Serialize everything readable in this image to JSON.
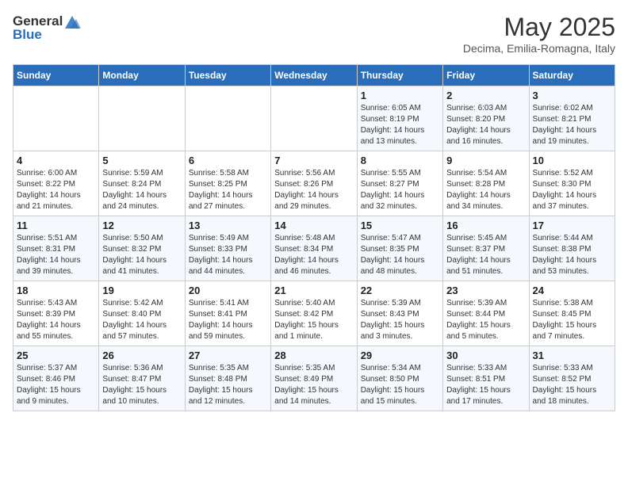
{
  "header": {
    "logo_general": "General",
    "logo_blue": "Blue",
    "month_year": "May 2025",
    "location": "Decima, Emilia-Romagna, Italy"
  },
  "days_of_week": [
    "Sunday",
    "Monday",
    "Tuesday",
    "Wednesday",
    "Thursday",
    "Friday",
    "Saturday"
  ],
  "weeks": [
    [
      {
        "day": "",
        "info": ""
      },
      {
        "day": "",
        "info": ""
      },
      {
        "day": "",
        "info": ""
      },
      {
        "day": "",
        "info": ""
      },
      {
        "day": "1",
        "info": "Sunrise: 6:05 AM\nSunset: 8:19 PM\nDaylight: 14 hours\nand 13 minutes."
      },
      {
        "day": "2",
        "info": "Sunrise: 6:03 AM\nSunset: 8:20 PM\nDaylight: 14 hours\nand 16 minutes."
      },
      {
        "day": "3",
        "info": "Sunrise: 6:02 AM\nSunset: 8:21 PM\nDaylight: 14 hours\nand 19 minutes."
      }
    ],
    [
      {
        "day": "4",
        "info": "Sunrise: 6:00 AM\nSunset: 8:22 PM\nDaylight: 14 hours\nand 21 minutes."
      },
      {
        "day": "5",
        "info": "Sunrise: 5:59 AM\nSunset: 8:24 PM\nDaylight: 14 hours\nand 24 minutes."
      },
      {
        "day": "6",
        "info": "Sunrise: 5:58 AM\nSunset: 8:25 PM\nDaylight: 14 hours\nand 27 minutes."
      },
      {
        "day": "7",
        "info": "Sunrise: 5:56 AM\nSunset: 8:26 PM\nDaylight: 14 hours\nand 29 minutes."
      },
      {
        "day": "8",
        "info": "Sunrise: 5:55 AM\nSunset: 8:27 PM\nDaylight: 14 hours\nand 32 minutes."
      },
      {
        "day": "9",
        "info": "Sunrise: 5:54 AM\nSunset: 8:28 PM\nDaylight: 14 hours\nand 34 minutes."
      },
      {
        "day": "10",
        "info": "Sunrise: 5:52 AM\nSunset: 8:30 PM\nDaylight: 14 hours\nand 37 minutes."
      }
    ],
    [
      {
        "day": "11",
        "info": "Sunrise: 5:51 AM\nSunset: 8:31 PM\nDaylight: 14 hours\nand 39 minutes."
      },
      {
        "day": "12",
        "info": "Sunrise: 5:50 AM\nSunset: 8:32 PM\nDaylight: 14 hours\nand 41 minutes."
      },
      {
        "day": "13",
        "info": "Sunrise: 5:49 AM\nSunset: 8:33 PM\nDaylight: 14 hours\nand 44 minutes."
      },
      {
        "day": "14",
        "info": "Sunrise: 5:48 AM\nSunset: 8:34 PM\nDaylight: 14 hours\nand 46 minutes."
      },
      {
        "day": "15",
        "info": "Sunrise: 5:47 AM\nSunset: 8:35 PM\nDaylight: 14 hours\nand 48 minutes."
      },
      {
        "day": "16",
        "info": "Sunrise: 5:45 AM\nSunset: 8:37 PM\nDaylight: 14 hours\nand 51 minutes."
      },
      {
        "day": "17",
        "info": "Sunrise: 5:44 AM\nSunset: 8:38 PM\nDaylight: 14 hours\nand 53 minutes."
      }
    ],
    [
      {
        "day": "18",
        "info": "Sunrise: 5:43 AM\nSunset: 8:39 PM\nDaylight: 14 hours\nand 55 minutes."
      },
      {
        "day": "19",
        "info": "Sunrise: 5:42 AM\nSunset: 8:40 PM\nDaylight: 14 hours\nand 57 minutes."
      },
      {
        "day": "20",
        "info": "Sunrise: 5:41 AM\nSunset: 8:41 PM\nDaylight: 14 hours\nand 59 minutes."
      },
      {
        "day": "21",
        "info": "Sunrise: 5:40 AM\nSunset: 8:42 PM\nDaylight: 15 hours\nand 1 minute."
      },
      {
        "day": "22",
        "info": "Sunrise: 5:39 AM\nSunset: 8:43 PM\nDaylight: 15 hours\nand 3 minutes."
      },
      {
        "day": "23",
        "info": "Sunrise: 5:39 AM\nSunset: 8:44 PM\nDaylight: 15 hours\nand 5 minutes."
      },
      {
        "day": "24",
        "info": "Sunrise: 5:38 AM\nSunset: 8:45 PM\nDaylight: 15 hours\nand 7 minutes."
      }
    ],
    [
      {
        "day": "25",
        "info": "Sunrise: 5:37 AM\nSunset: 8:46 PM\nDaylight: 15 hours\nand 9 minutes."
      },
      {
        "day": "26",
        "info": "Sunrise: 5:36 AM\nSunset: 8:47 PM\nDaylight: 15 hours\nand 10 minutes."
      },
      {
        "day": "27",
        "info": "Sunrise: 5:35 AM\nSunset: 8:48 PM\nDaylight: 15 hours\nand 12 minutes."
      },
      {
        "day": "28",
        "info": "Sunrise: 5:35 AM\nSunset: 8:49 PM\nDaylight: 15 hours\nand 14 minutes."
      },
      {
        "day": "29",
        "info": "Sunrise: 5:34 AM\nSunset: 8:50 PM\nDaylight: 15 hours\nand 15 minutes."
      },
      {
        "day": "30",
        "info": "Sunrise: 5:33 AM\nSunset: 8:51 PM\nDaylight: 15 hours\nand 17 minutes."
      },
      {
        "day": "31",
        "info": "Sunrise: 5:33 AM\nSunset: 8:52 PM\nDaylight: 15 hours\nand 18 minutes."
      }
    ]
  ]
}
